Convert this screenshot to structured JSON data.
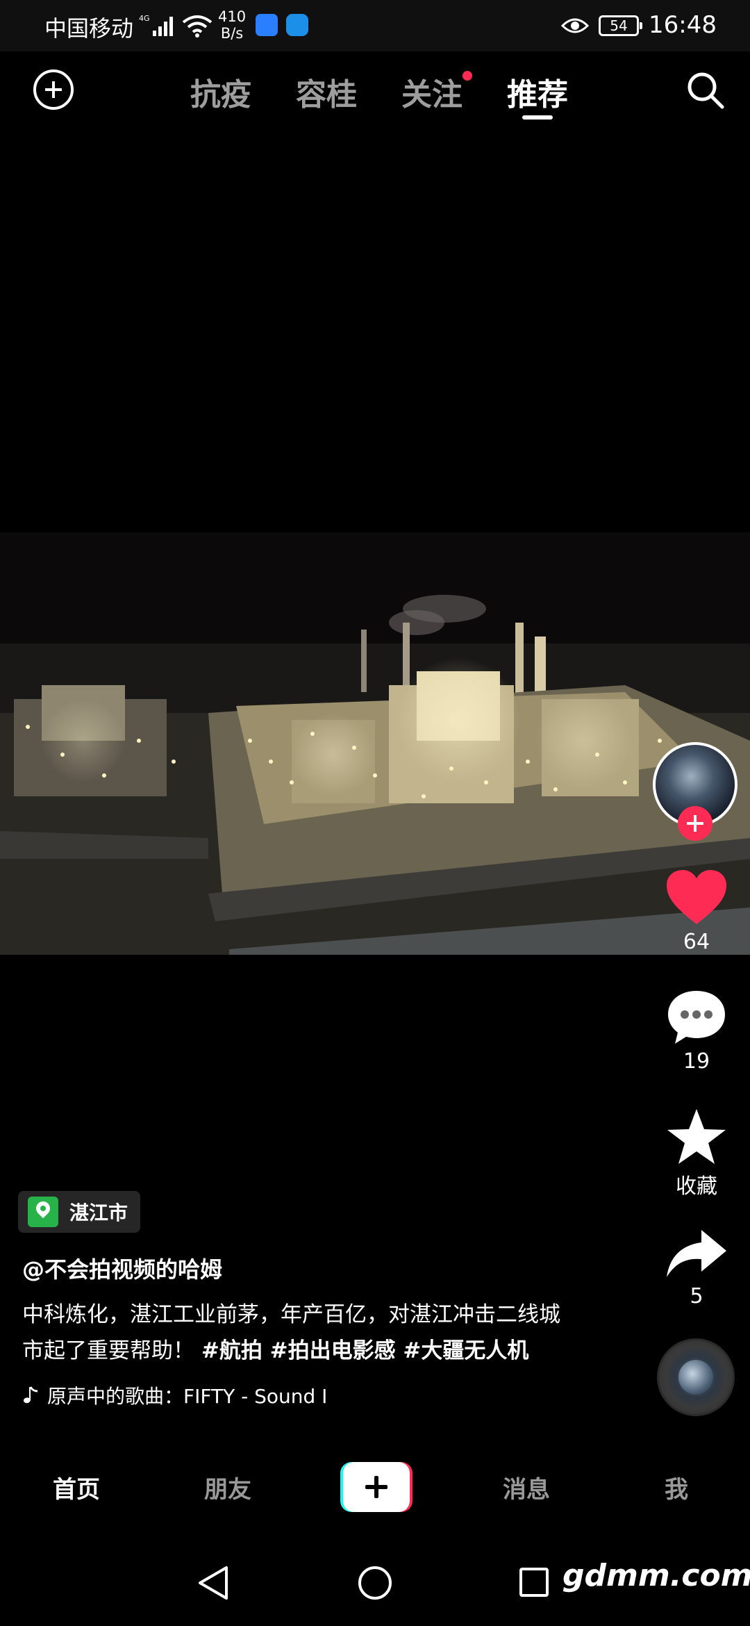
{
  "status_bar": {
    "carrier": "中国移动",
    "network_speed_value": "410",
    "network_speed_unit": "B/s",
    "battery": "54",
    "time": "16:48"
  },
  "top_nav": {
    "tabs": [
      {
        "label": "抗疫"
      },
      {
        "label": "容桂"
      },
      {
        "label": "关注"
      },
      {
        "label": "推荐"
      }
    ],
    "active_tab": "推荐"
  },
  "actions": {
    "likes": "64",
    "comments": "19",
    "favorite_label": "收藏",
    "shares": "5"
  },
  "caption": {
    "location": "湛江市",
    "author": "@不会拍视频的哈姆",
    "description": "中科炼化，湛江工业前茅，年产百亿，对湛江冲击二线城市起了重要帮助！",
    "hashtags": "#航拍 #拍出电影感 #大疆无人机",
    "music": "原声中的歌曲：FIFTY - Sound I"
  },
  "bottom_nav": {
    "items": [
      {
        "label": "首页"
      },
      {
        "label": "朋友"
      },
      {
        "label": "消息"
      },
      {
        "label": "我"
      }
    ]
  },
  "watermark": "gdmm.com",
  "colors": {
    "accent_red": "#fe2c55",
    "accent_cyan": "#25f4ee",
    "location_green": "#27b24a"
  }
}
